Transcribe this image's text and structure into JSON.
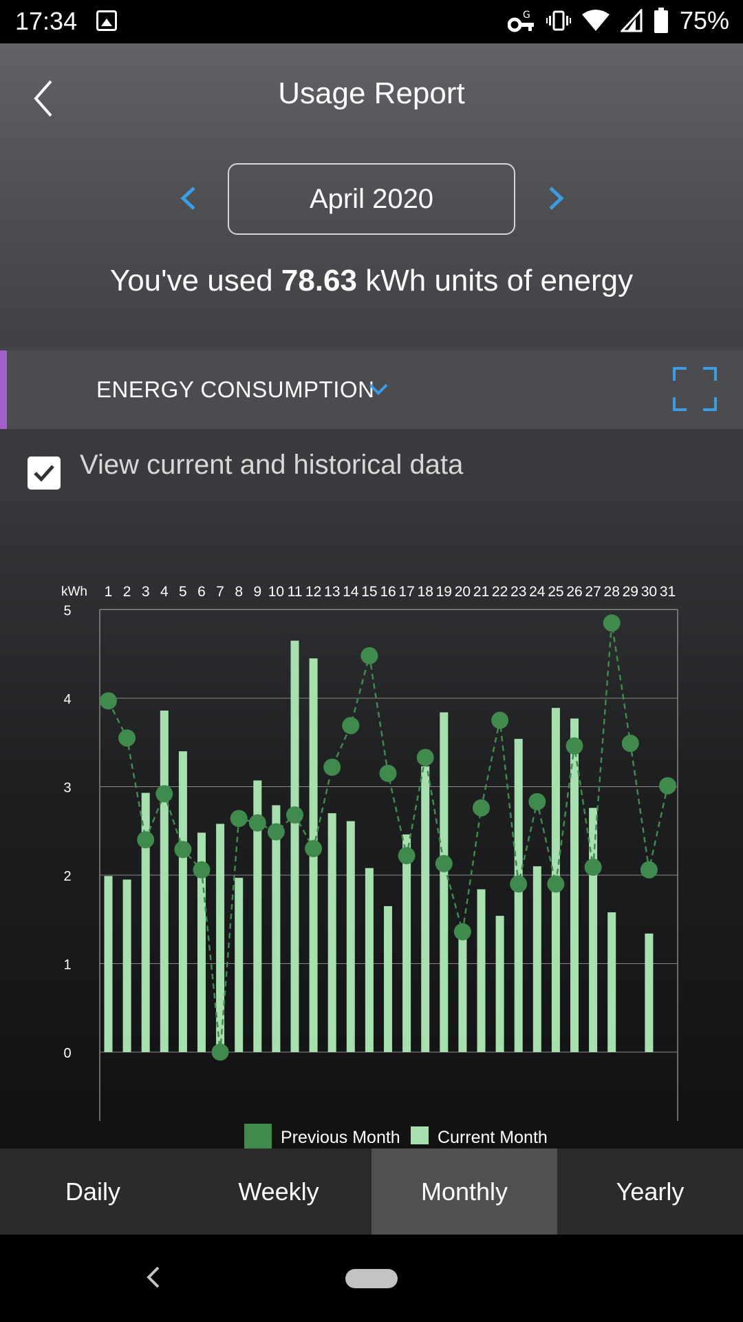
{
  "status_bar": {
    "time": "17:34",
    "battery": "75%",
    "icons": [
      "image-icon",
      "vpn-key-icon",
      "vibrate-icon",
      "wifi-icon",
      "signal-icon",
      "battery-icon"
    ]
  },
  "header": {
    "title": "Usage Report",
    "month": "April 2020",
    "usage_prefix": "You've used",
    "usage_value": "78.63",
    "usage_suffix": "kWh units of energy"
  },
  "section": {
    "title": "ENERGY CONSUMPTION",
    "accent_color": "#a35fc9"
  },
  "checkbox": {
    "label": "View current and historical data",
    "checked": true
  },
  "chart_data": {
    "type": "bar",
    "ylabel": "kWh",
    "ylim": [
      0,
      5.3
    ],
    "yticks": [
      0,
      1,
      2,
      3,
      4,
      5
    ],
    "grid": true,
    "legend_position": "bottom",
    "categories": [
      "1",
      "2",
      "3",
      "4",
      "5",
      "6",
      "7",
      "8",
      "9",
      "10",
      "11",
      "12",
      "13",
      "14",
      "15",
      "16",
      "17",
      "18",
      "19",
      "20",
      "21",
      "22",
      "23",
      "24",
      "25",
      "26",
      "27",
      "28",
      "29",
      "30",
      "31"
    ],
    "series": [
      {
        "name": "Current Month",
        "type": "bar",
        "color": "#a8dfae",
        "values": [
          1.99,
          1.95,
          2.93,
          3.86,
          3.4,
          2.48,
          2.58,
          1.97,
          3.07,
          2.79,
          4.65,
          4.45,
          2.7,
          2.61,
          2.08,
          1.65,
          2.46,
          3.23,
          3.84,
          1.35,
          1.84,
          1.54,
          3.54,
          2.1,
          3.89,
          3.77,
          2.76,
          1.58,
          null,
          1.34,
          null
        ]
      },
      {
        "name": "Previous Month",
        "type": "line",
        "color": "#3f8a4c",
        "values": [
          3.97,
          3.55,
          2.4,
          2.92,
          2.29,
          2.06,
          0.0,
          2.64,
          2.59,
          2.49,
          2.68,
          2.3,
          3.22,
          3.69,
          4.48,
          3.15,
          2.22,
          3.33,
          2.13,
          1.36,
          2.76,
          3.75,
          1.9,
          2.83,
          1.9,
          3.46,
          2.09,
          4.85,
          3.49,
          2.06,
          3.01
        ]
      }
    ]
  },
  "tabs": [
    {
      "label": "Daily",
      "active": false
    },
    {
      "label": "Weekly",
      "active": false
    },
    {
      "label": "Monthly",
      "active": true
    },
    {
      "label": "Yearly",
      "active": false
    }
  ],
  "colors": {
    "accent_blue": "#3d9be3",
    "bar_current": "#a8dfae",
    "line_previous": "#3f8a4c",
    "tab_active": "#505052"
  }
}
